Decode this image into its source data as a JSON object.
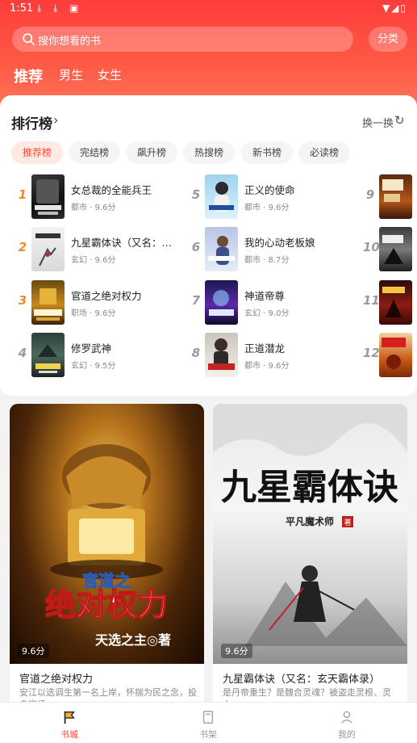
{
  "status_bar": {
    "time": "1:51",
    "indicators": [
      "⤓",
      "⤓",
      "▣"
    ],
    "right": "▼◢▯"
  },
  "search": {
    "placeholder": "搜你想看的书"
  },
  "category_button": "分类",
  "tabs": [
    {
      "label": "推荐",
      "active": true
    },
    {
      "label": "男生",
      "active": false
    },
    {
      "label": "女生",
      "active": false
    }
  ],
  "ranking": {
    "title": "排行榜",
    "refresh_label": "换一换",
    "chips": [
      {
        "label": "推荐榜",
        "active": true
      },
      {
        "label": "完结榜",
        "active": false
      },
      {
        "label": "飙升榜",
        "active": false
      },
      {
        "label": "热搜榜",
        "active": false
      },
      {
        "label": "新书榜",
        "active": false
      },
      {
        "label": "必读榜",
        "active": false
      }
    ],
    "books": [
      {
        "rank": "1",
        "name": "女总裁的全能兵王",
        "meta": "都市 · 9.6分"
      },
      {
        "rank": "2",
        "name": "九星霸体诀（又名：玄天霸体录）",
        "meta": "玄幻 · 9.6分"
      },
      {
        "rank": "3",
        "name": "官道之绝对权力",
        "meta": "职场 · 9.6分"
      },
      {
        "rank": "4",
        "name": "修罗武神",
        "meta": "玄幻 · 9.5分"
      },
      {
        "rank": "5",
        "name": "正义的使命",
        "meta": "都市 · 9.6分"
      },
      {
        "rank": "6",
        "name": "我的心动老板娘",
        "meta": "都市 · 8.7分"
      },
      {
        "rank": "7",
        "name": "神道帝尊",
        "meta": "玄幻 · 9.0分"
      },
      {
        "rank": "8",
        "name": "正道潜龙",
        "meta": "都市 · 9.6分"
      },
      {
        "rank": "9",
        "name": "",
        "meta": ""
      },
      {
        "rank": "10",
        "name": "",
        "meta": ""
      },
      {
        "rank": "11",
        "name": "",
        "meta": ""
      },
      {
        "rank": "12",
        "name": "",
        "meta": ""
      }
    ]
  },
  "featured": [
    {
      "title": "官道之绝对权力",
      "score": "9.6分",
      "cover_text": "官道之绝对权力",
      "cover_author": "天选之主◎著",
      "description": "安江以选调生第一名上岸，怀揣为民之念，投身官场……"
    },
    {
      "title": "九星霸体诀（又名：玄天霸体录）",
      "score": "9.6分",
      "cover_text": "九星霸体诀",
      "cover_author": "平凡魔术师",
      "cover_seal": "著",
      "description": "是丹帝重生？是魏合灵魂？被盗走灵根、灵力……"
    }
  ],
  "bottom_nav": [
    {
      "label": "书城",
      "active": true
    },
    {
      "label": "书架",
      "active": false
    },
    {
      "label": "我的",
      "active": false
    }
  ]
}
